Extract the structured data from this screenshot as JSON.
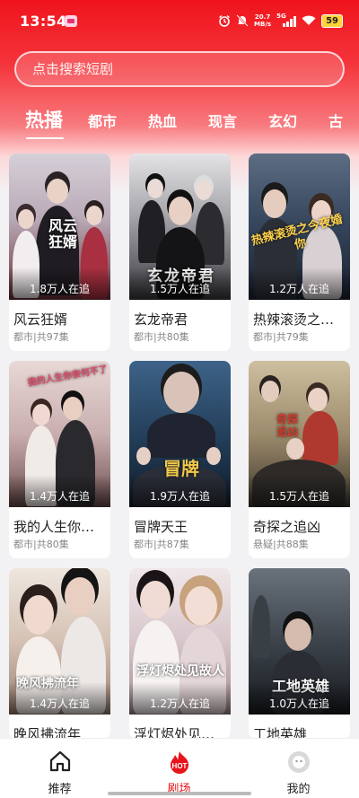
{
  "status": {
    "time": "13:54",
    "net_speed_value": "20.7",
    "net_speed_unit": "MB/s",
    "network": "5G",
    "battery": "59"
  },
  "search": {
    "placeholder": "点击搜索短剧"
  },
  "tabs": [
    {
      "label": "热播",
      "active": true
    },
    {
      "label": "都市"
    },
    {
      "label": "热血"
    },
    {
      "label": "现言"
    },
    {
      "label": "玄幻"
    },
    {
      "label": "古"
    }
  ],
  "dramas": [
    {
      "title": "风云狂婿",
      "poster_text": "风云狂婿",
      "viewers": "1.8万人在追",
      "meta": "都市|共97集",
      "palette": [
        "#c9c3cf",
        "#7a3a44"
      ]
    },
    {
      "title": "玄龙帝君",
      "poster_text": "玄龙帝君",
      "viewers": "1.5万人在追",
      "meta": "都市|共80集",
      "palette": [
        "#b8b8bc",
        "#2a2a30"
      ]
    },
    {
      "title": "热辣滚烫之…",
      "poster_text": "热辣滚烫之今夜婚你",
      "viewers": "1.2万人在追",
      "meta": "都市|共79集",
      "palette": [
        "#3c4d63",
        "#1d2431"
      ]
    },
    {
      "title": "我的人生你…",
      "poster_text": "我的人生你奈何不了",
      "viewers": "1.4万人在追",
      "meta": "都市|共80集",
      "palette": [
        "#d9c6c3",
        "#7a5a58"
      ]
    },
    {
      "title": "冒牌天王",
      "poster_text": "冒牌",
      "viewers": "1.9万人在追",
      "meta": "都市|共87集",
      "palette": [
        "#2f4d6b",
        "#15283b"
      ]
    },
    {
      "title": "奇探之追凶",
      "poster_text": "奇探追凶",
      "viewers": "1.5万人在追",
      "meta": "悬疑|共88集",
      "palette": [
        "#b4a789",
        "#4d4335"
      ]
    },
    {
      "title": "晚风拂流年",
      "poster_text": "晚风拂流年",
      "viewers": "1.4万人在追",
      "meta": "",
      "palette": [
        "#e6dcd4",
        "#8e7466"
      ]
    },
    {
      "title": "浮灯烬处见…",
      "poster_text": "浮灯烬处见故人",
      "viewers": "1.2万人在追",
      "meta": "",
      "palette": [
        "#e8dfe2",
        "#a38b90"
      ]
    },
    {
      "title": "工地英雄",
      "poster_text": "工地英雄",
      "viewers": "1.0万人在追",
      "meta": "",
      "palette": [
        "#4a5058",
        "#1e2226"
      ]
    }
  ],
  "nav": [
    {
      "label": "推荐",
      "icon": "home-icon"
    },
    {
      "label": "剧场",
      "icon": "hot-icon",
      "badge": "HOT",
      "active": true
    },
    {
      "label": "我的",
      "icon": "profile-icon"
    }
  ],
  "colors": {
    "accent": "#e8141c"
  }
}
